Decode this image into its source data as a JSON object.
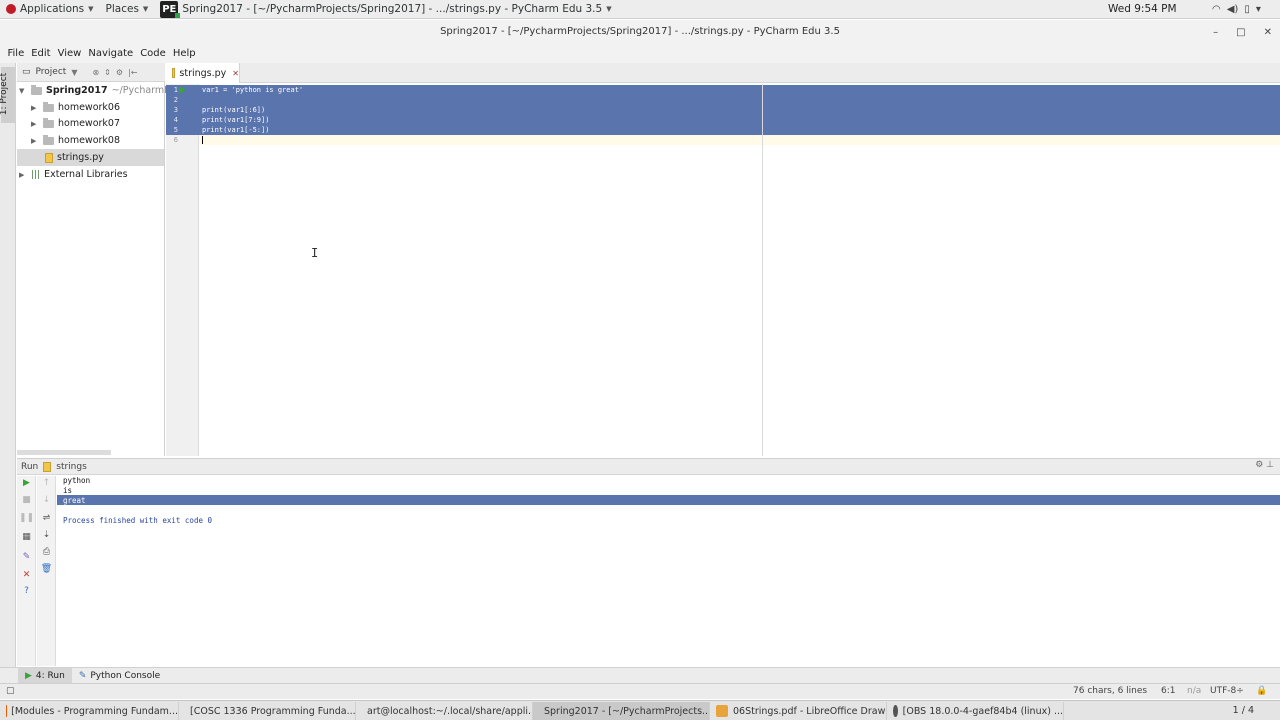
{
  "topbar": {
    "applications": "Applications",
    "places": "Places",
    "app_icon_text": "PE",
    "active_window": "Spring2017 - [~/PycharmProjects/Spring2017] - .../strings.py - PyCharm Edu 3.5",
    "clock": "Wed  9:54 PM"
  },
  "window": {
    "title": "Spring2017 - [~/PycharmProjects/Spring2017] - .../strings.py - PyCharm Edu 3.5",
    "minimize": "–",
    "maximize": "□",
    "close": "✕"
  },
  "menu": [
    "File",
    "Edit",
    "View",
    "Navigate",
    "Code",
    "Help"
  ],
  "left_strip": {
    "project_tab": "1: Project"
  },
  "project": {
    "header": "Project",
    "root": {
      "name": "Spring2017",
      "path": "~/PycharmPro..."
    },
    "items": [
      "homework06",
      "homework07",
      "homework08",
      "strings.py"
    ],
    "external": "External Libraries"
  },
  "editor": {
    "tab": "strings.py",
    "line_numbers": [
      "1",
      "2",
      "3",
      "4",
      "5",
      "6"
    ],
    "lines": [
      "var1 = 'python is great'",
      "",
      "print(var1[:6])",
      "print(var1[7:9])",
      "print(var1[-5:])",
      ""
    ]
  },
  "run": {
    "label": "Run",
    "config": "strings",
    "output": [
      "python",
      "is",
      "great",
      "",
      "Process finished with exit code 0"
    ]
  },
  "bottom_tabs": [
    "4: Run",
    "Python Console"
  ],
  "status": {
    "chars": "76 chars, 6 lines",
    "position": "6:1",
    "na": "n/a",
    "encoding": "UTF-8÷"
  },
  "taskbar": {
    "tasks": [
      "[Modules - Programming Fundam...",
      "[COSC 1336 Programming Funda...",
      "art@localhost:~/.local/share/appli...",
      "Spring2017 - [~/PycharmProjects...",
      "06Strings.pdf - LibreOffice Draw",
      "[OBS 18.0.0-4-gaef84b4 (linux) ..."
    ],
    "pager": "1 / 4"
  }
}
